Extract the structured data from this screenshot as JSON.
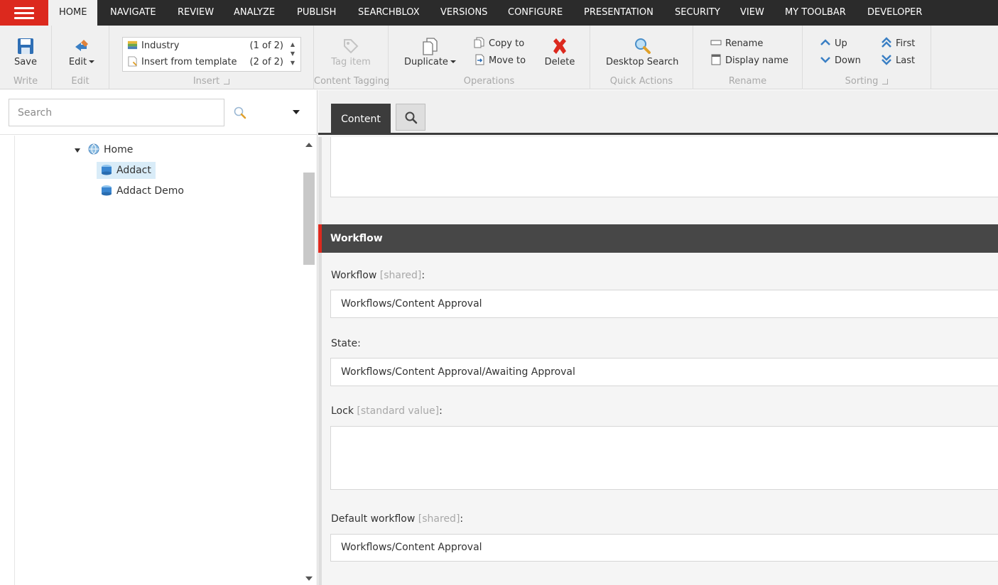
{
  "nav": {
    "tabs": [
      {
        "label": "HOME",
        "active": true
      },
      {
        "label": "NAVIGATE"
      },
      {
        "label": "REVIEW"
      },
      {
        "label": "ANALYZE"
      },
      {
        "label": "PUBLISH"
      },
      {
        "label": "SEARCHBLOX"
      },
      {
        "label": "VERSIONS"
      },
      {
        "label": "CONFIGURE"
      },
      {
        "label": "PRESENTATION"
      },
      {
        "label": "SECURITY"
      },
      {
        "label": "VIEW"
      },
      {
        "label": "MY TOOLBAR"
      },
      {
        "label": "DEVELOPER"
      }
    ]
  },
  "ribbon": {
    "write": {
      "label": "Write",
      "save": "Save"
    },
    "edit": {
      "label": "Edit",
      "edit": "Edit"
    },
    "insert": {
      "label": "Insert",
      "items": [
        {
          "name": "Industry",
          "count": "(1 of 2)"
        },
        {
          "name": "Insert from template",
          "count": "(2 of 2)"
        }
      ]
    },
    "tagging": {
      "label": "Content Tagging",
      "tag_item": "Tag item"
    },
    "operations": {
      "label": "Operations",
      "duplicate": "Duplicate",
      "copy_to": "Copy to",
      "move_to": "Move to",
      "delete": "Delete"
    },
    "quick": {
      "label": "Quick Actions",
      "desktop_search": "Desktop Search"
    },
    "rename": {
      "label": "Rename",
      "rename": "Rename",
      "display_name": "Display name"
    },
    "sorting": {
      "label": "Sorting",
      "up": "Up",
      "down": "Down",
      "first": "First",
      "last": "Last"
    }
  },
  "search": {
    "placeholder": "Search"
  },
  "tree": {
    "home": "Home",
    "children": [
      "Addact",
      "Addact Demo"
    ],
    "selected": "Addact"
  },
  "content": {
    "tab_label": "Content",
    "section_title": "Workflow",
    "fields": [
      {
        "label": "Workflow",
        "meta": "[shared]",
        "value": "Workflows/Content Approval"
      },
      {
        "label": "State",
        "meta": "",
        "value": "Workflows/Content Approval/Awaiting Approval"
      },
      {
        "label": "Lock",
        "meta": "[standard value]",
        "value": ""
      },
      {
        "label": "Default workflow",
        "meta": "[shared]",
        "value": "Workflows/Content Approval"
      }
    ]
  },
  "colors": {
    "accent": "#dc291e",
    "nav_bg": "#2b2b2b",
    "section_bg": "#474747"
  }
}
